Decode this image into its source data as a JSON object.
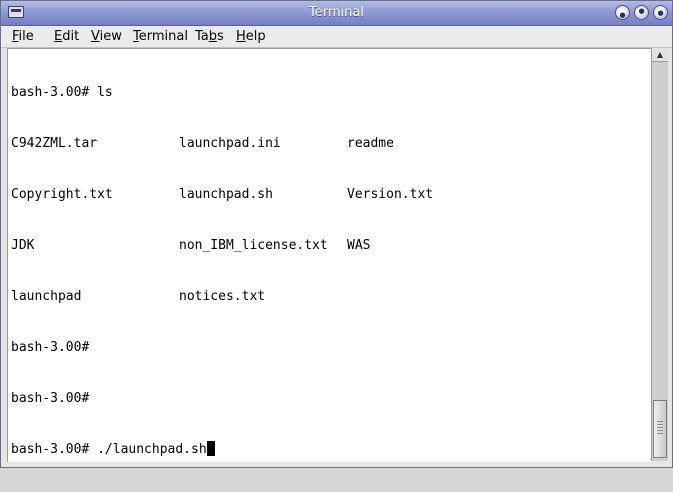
{
  "window": {
    "title": "Terminal",
    "controls": {
      "minimize": "●",
      "maximize": "●",
      "close": "●"
    }
  },
  "menubar": {
    "items": [
      {
        "pre": "",
        "ul": "F",
        "post": "ile"
      },
      {
        "pre": "",
        "ul": "E",
        "post": "dit"
      },
      {
        "pre": "",
        "ul": "V",
        "post": "iew"
      },
      {
        "pre": "",
        "ul": "T",
        "post": "erminal"
      },
      {
        "pre": "Ta",
        "ul": "b",
        "post": "s"
      },
      {
        "pre": "",
        "ul": "H",
        "post": "elp"
      }
    ]
  },
  "terminal": {
    "prompt_ls": "bash-3.00# ls",
    "files": [
      [
        "C942ZML.tar",
        "launchpad.ini",
        "readme"
      ],
      [
        "Copyright.txt",
        "launchpad.sh",
        "Version.txt"
      ],
      [
        "JDK",
        "non_IBM_license.txt",
        "WAS"
      ],
      [
        "launchpad",
        "notices.txt",
        ""
      ]
    ],
    "prompt_empty_1": "bash-3.00#",
    "prompt_empty_2": "bash-3.00#",
    "prompt_current": "bash-3.00# ./launchpad.sh"
  },
  "scrollbar": {
    "up_arrow": "▲"
  }
}
